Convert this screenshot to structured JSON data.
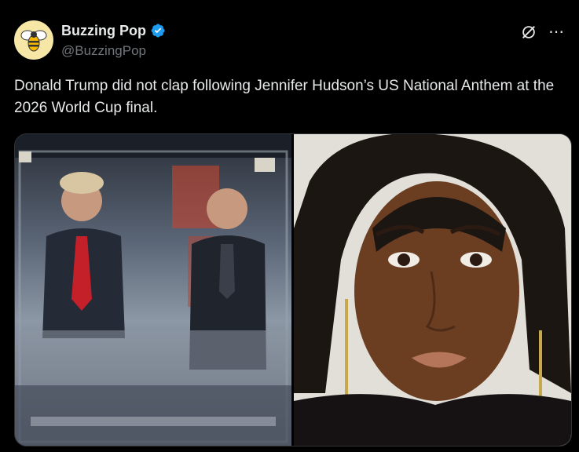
{
  "author": {
    "display_name": "Buzzing Pop",
    "handle": "@BuzzingPop",
    "verified": true,
    "avatar_icon": "bee-icon"
  },
  "post": {
    "text": "Donald Trump did not clap following Jennifer Hudson’s US National Anthem at the 2026 World Cup final."
  },
  "icons": {
    "grok": "grok-icon",
    "more": "⋯"
  },
  "colors": {
    "background": "#000000",
    "text": "#e7e9ea",
    "muted": "#71767b",
    "verified": "#1d9bf0",
    "border": "#2f3336"
  }
}
